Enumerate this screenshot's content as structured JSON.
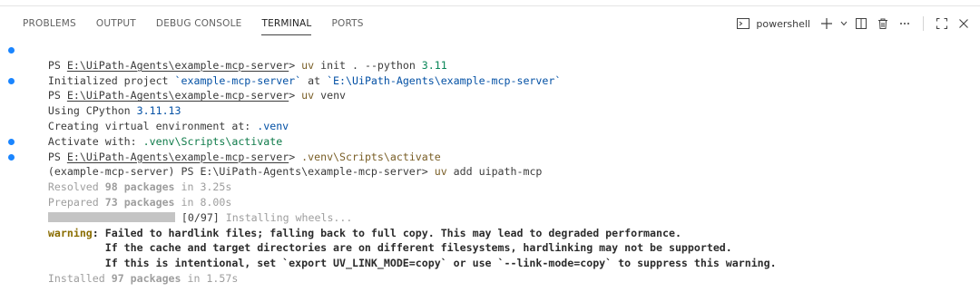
{
  "panel": {
    "tabs": [
      {
        "label": "PROBLEMS"
      },
      {
        "label": "OUTPUT"
      },
      {
        "label": "DEBUG CONSOLE"
      },
      {
        "label": "TERMINAL"
      },
      {
        "label": "PORTS"
      }
    ],
    "active_tab": "TERMINAL",
    "terminal_name": "powershell",
    "icons": [
      "terminal-icon",
      "add-icon",
      "chevron-down-icon",
      "split-icon",
      "trash-icon",
      "more-icon",
      "maximize-icon",
      "close-icon"
    ]
  },
  "terminal": {
    "prompt": "PS ",
    "cwd": "E:\\UiPath-Agents\\example-mcp-server",
    "venv_prefix": "(example-mcp-server) PS ",
    "l1": {
      "cmd": "uv",
      "rest": " init . --python ",
      "ver": "3.11"
    },
    "l2": {
      "a": "Initialized project ",
      "b": "`example-mcp-server`",
      "c": " at ",
      "d": "`E:\\UiPath-Agents\\example-mcp-server`"
    },
    "l3": {
      "cmd": "uv",
      "rest": " venv"
    },
    "l4": {
      "a": "Using CPython ",
      "b": "3.11.13"
    },
    "l5": {
      "a": "Creating virtual environment at: ",
      "b": ".venv"
    },
    "l6": {
      "a": "Activate with: ",
      "b": ".venv\\Scripts\\activate"
    },
    "l7": {
      "cmd": ".venv\\Scripts\\activate"
    },
    "l8": {
      "cmd": "uv",
      "rest": " add uipath-mcp"
    },
    "l9": {
      "a": "Resolved ",
      "b": "98 packages",
      "c": " in 3.25s"
    },
    "l10": {
      "a": "Prepared ",
      "b": "73 packages",
      "c": " in 8.00s"
    },
    "l11": {
      "a": " [0/97] ",
      "b": "Installing wheels..."
    },
    "l12": {
      "a": "warning",
      "b": ": Failed to hardlink files; falling back to full copy. This may lead to degraded performance."
    },
    "l13": {
      "a": "         If the cache and target directories are on different filesystems, hardlinking may not be supported."
    },
    "l14": {
      "a": "         If this is intentional, set `export UV_LINK_MODE=copy` or use `--link-mode=copy` to suppress this warning."
    },
    "l15": {
      "a": "Installed ",
      "b": "97 packages",
      "c": " in 1.57s"
    }
  },
  "colors": {
    "accent": "#1a85ff",
    "command": "#795e26",
    "number": "#098658",
    "string": "#0451a5",
    "path": "#0f7b4a",
    "dim": "#9e9e9e",
    "warning": "#8a6d00"
  }
}
